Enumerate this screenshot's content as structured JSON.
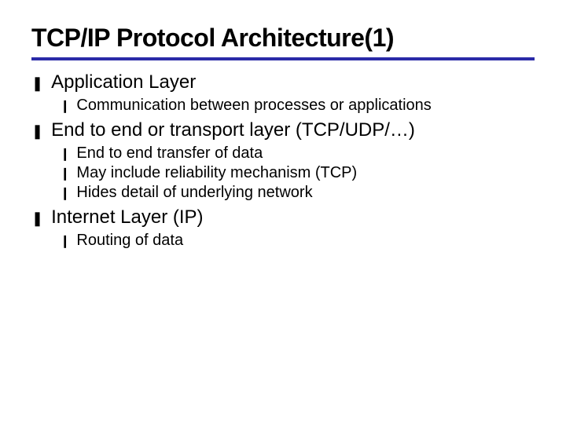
{
  "title": "TCP/IP Protocol Architecture(1)",
  "bullets": {
    "level1": "❚",
    "level2": "❙"
  },
  "sections": [
    {
      "heading": "Application Layer",
      "heading_style": "arial",
      "items": [
        "Communication between processes or applications"
      ]
    },
    {
      "heading": "End to end or transport layer (TCP/UDP/…)",
      "heading_style": "bold",
      "items": [
        "End to end transfer of data",
        "May include reliability mechanism (TCP)",
        "Hides detail of underlying network"
      ]
    },
    {
      "heading": "Internet Layer (IP)",
      "heading_style": "arial",
      "items": [
        "Routing of data"
      ]
    }
  ]
}
